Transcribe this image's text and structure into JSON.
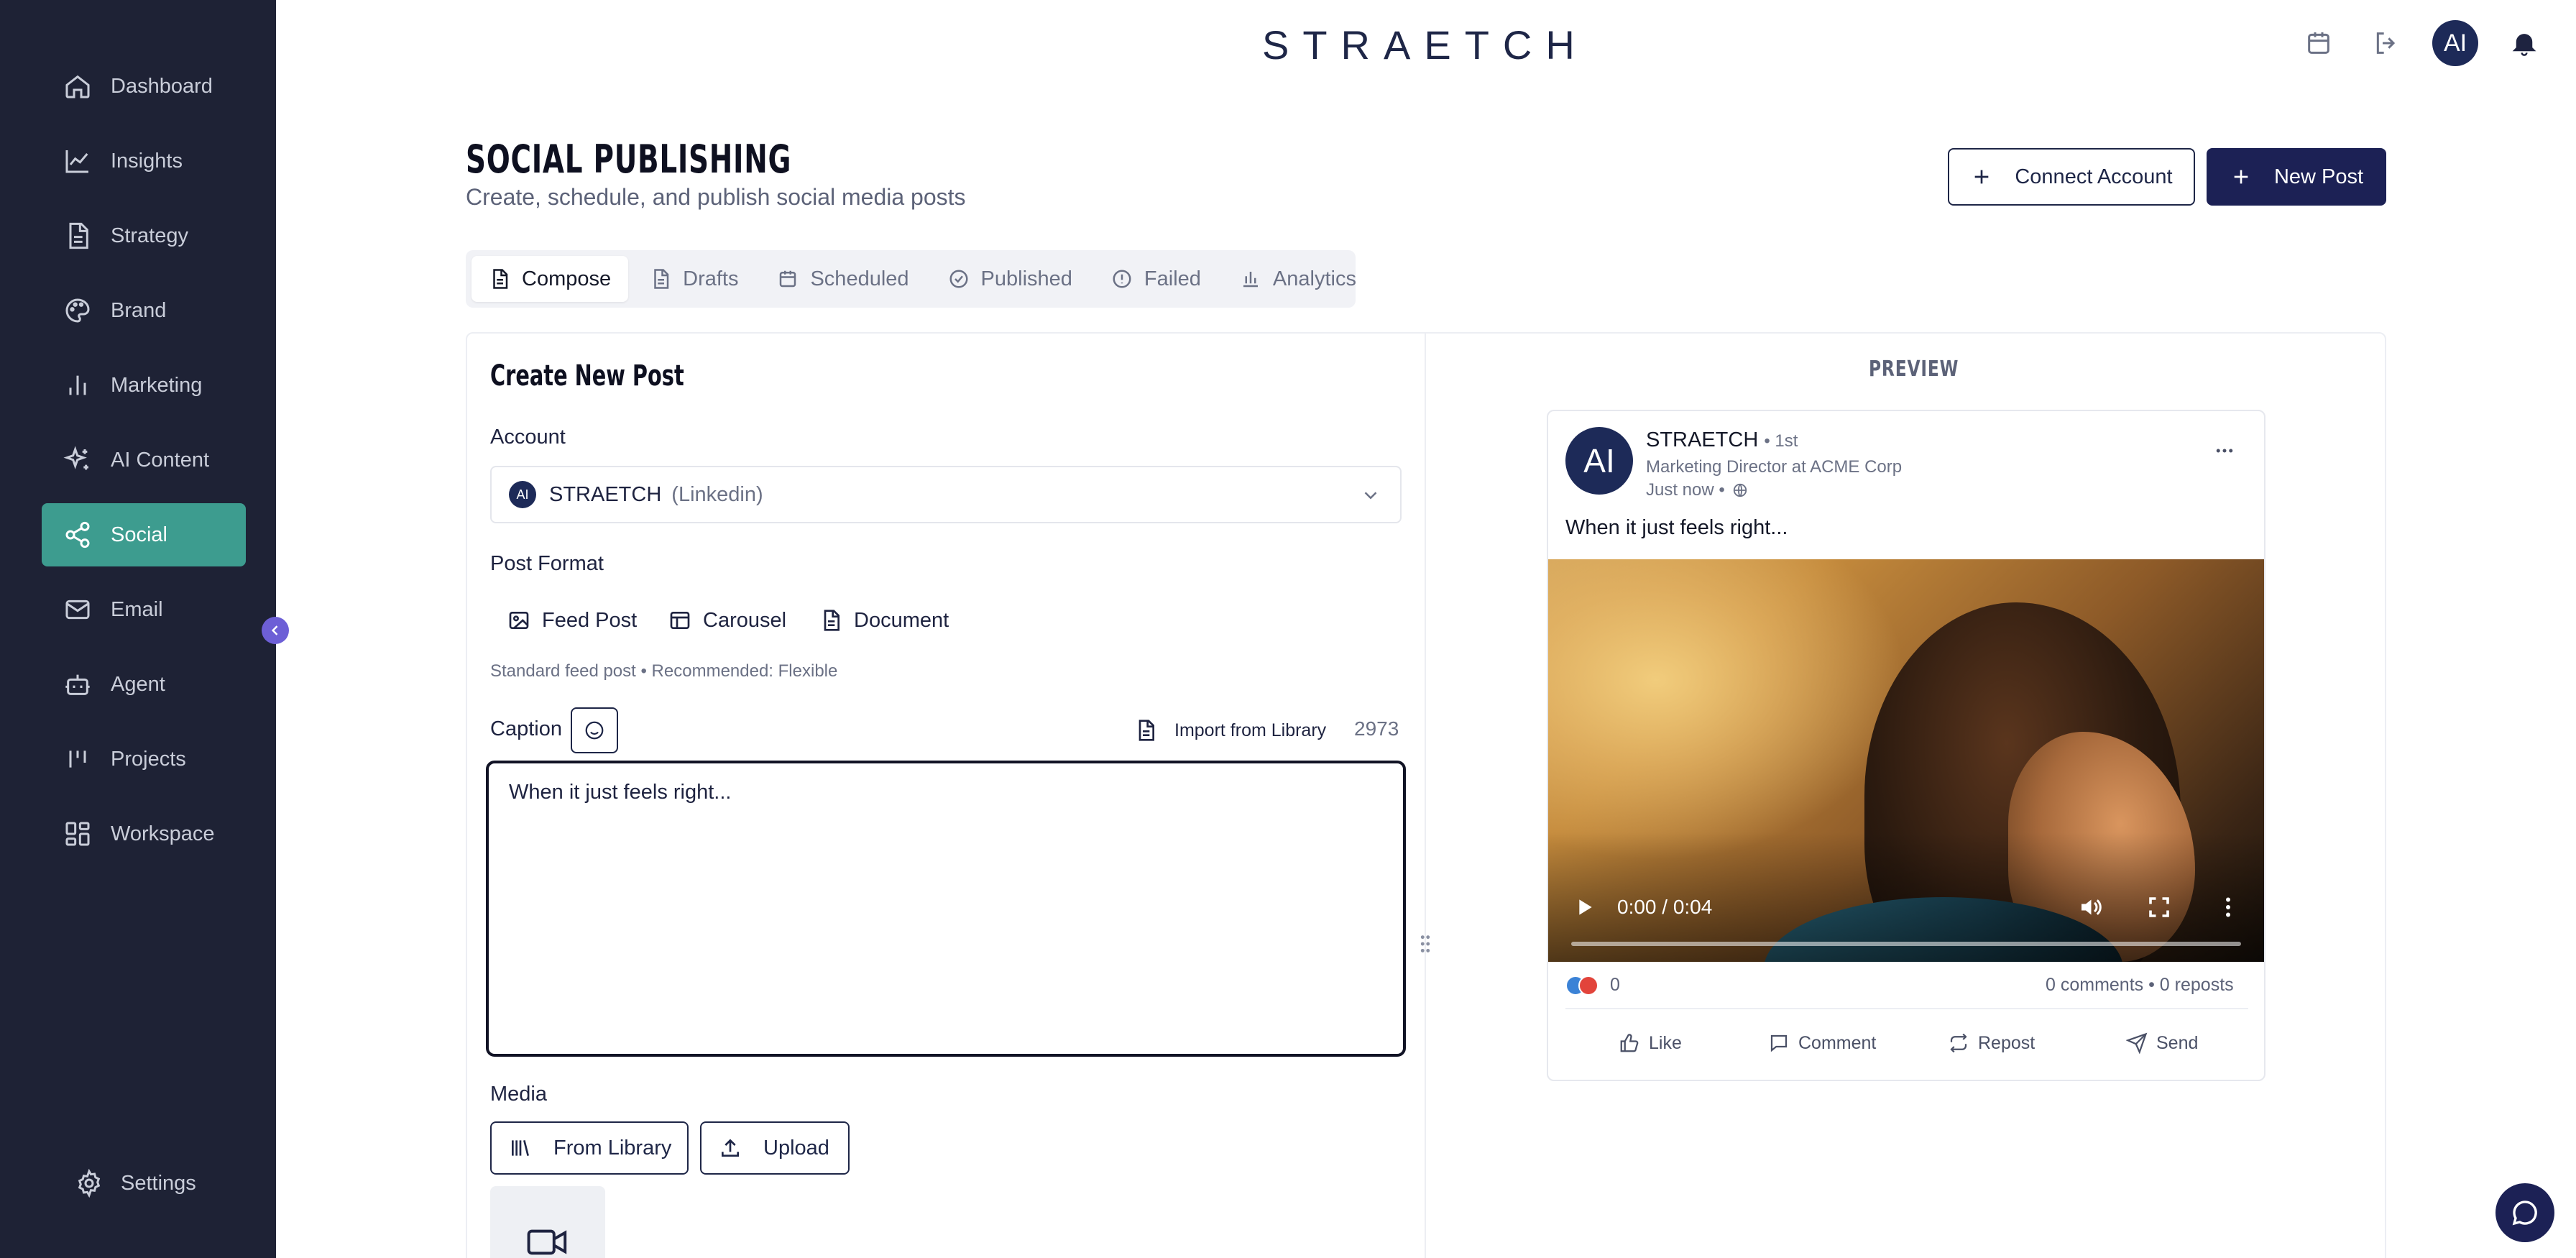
{
  "app": {
    "logo": "STRAETCH"
  },
  "sidebar": {
    "items": [
      {
        "label": "Dashboard",
        "icon": "home-icon"
      },
      {
        "label": "Insights",
        "icon": "trend-icon"
      },
      {
        "label": "Strategy",
        "icon": "document-icon"
      },
      {
        "label": "Brand",
        "icon": "palette-icon"
      },
      {
        "label": "Marketing",
        "icon": "bar-chart-icon"
      },
      {
        "label": "AI Content",
        "icon": "sparkle-icon"
      },
      {
        "label": "Social",
        "icon": "share-icon",
        "active": true
      },
      {
        "label": "Email",
        "icon": "mail-icon"
      },
      {
        "label": "Agent",
        "icon": "bot-icon"
      },
      {
        "label": "Projects",
        "icon": "kanban-icon"
      },
      {
        "label": "Workspace",
        "icon": "grid-icon"
      }
    ],
    "settings_label": "Settings"
  },
  "header": {
    "avatar_text": "AI"
  },
  "page": {
    "title": "SOCIAL PUBLISHING",
    "subtitle": "Create, schedule, and publish social media posts",
    "connect_label": "Connect Account",
    "new_post_label": "New Post"
  },
  "tabs": [
    "Compose",
    "Drafts",
    "Scheduled",
    "Published",
    "Failed",
    "Analytics"
  ],
  "composer": {
    "heading": "Create New Post",
    "account_label": "Account",
    "account_avatar": "AI",
    "account_name": "STRAETCH",
    "account_network": "(Linkedin)",
    "format_label": "Post Format",
    "formats": [
      "Feed Post",
      "Carousel",
      "Document"
    ],
    "format_hint": "Standard feed post • Recommended: Flexible",
    "caption_label": "Caption",
    "import_label": "Import from Library",
    "char_count": "2973",
    "caption_text": "When it just feels right...",
    "media_label": "Media",
    "from_library_label": "From Library",
    "upload_label": "Upload"
  },
  "preview": {
    "title": "PREVIEW",
    "avatar": "AI",
    "name": "STRAETCH",
    "degree": "• 1st",
    "role": "Marketing Director at ACME Corp",
    "time": "Just now •",
    "text": "When it just feels right...",
    "video_time": "0:00 / 0:04",
    "reaction_count": "0",
    "stats": "0 comments  •  0 reposts",
    "actions": [
      "Like",
      "Comment",
      "Repost",
      "Send"
    ]
  },
  "colors": {
    "sidebar_bg": "#1e2235",
    "active": "#3d9c8f",
    "primary": "#1c2155"
  }
}
